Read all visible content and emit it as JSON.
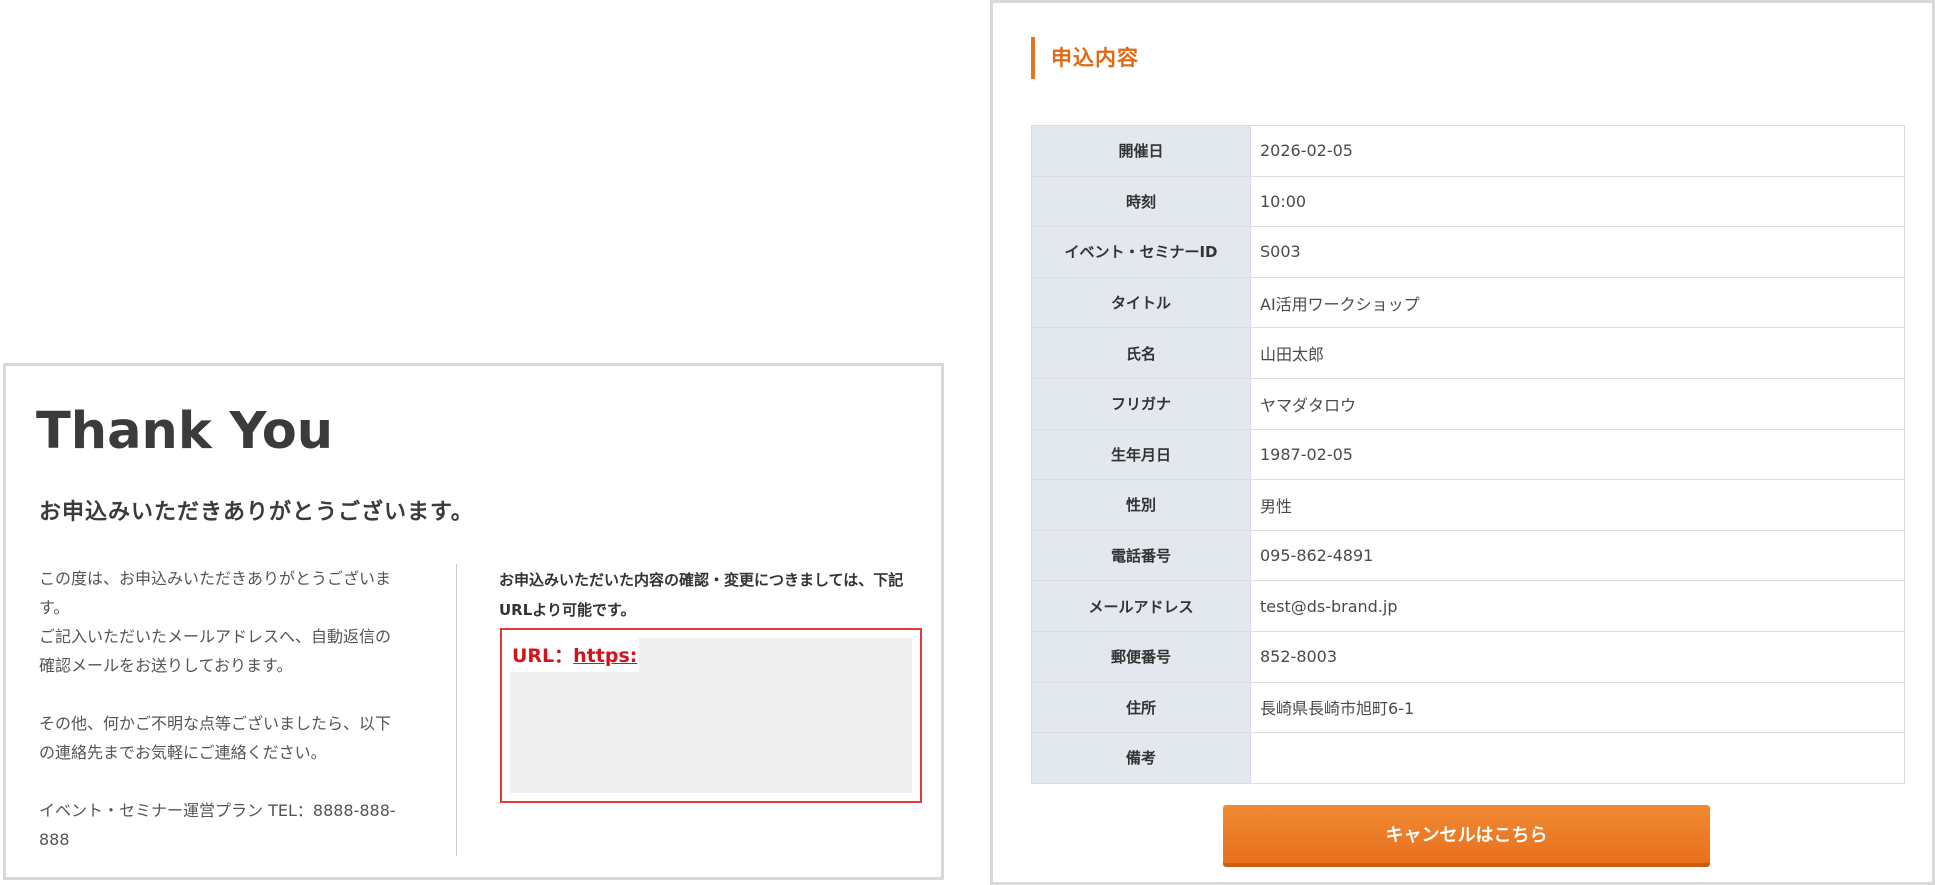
{
  "thanks": {
    "title": "Thank You",
    "subtitle": "お申込みいただきありがとうございます。",
    "paragraph1": "この度は、お申込みいただきありがとうございま\nす。\nご記入いただいたメールアドレスへ、自動返信の\n確認メールをお送りしております。",
    "paragraph2": "その他、何かご不明な点等ございましたら、以下\nの連絡先までお気軽にご連絡ください。",
    "paragraph3": "イベント・セミナー運営プラン TEL：8888-888-\n888",
    "note": "お申込みいただいた内容の確認・変更につきましては、下記URLより可能です。",
    "url_label": "URL：",
    "url_link": "https:"
  },
  "application": {
    "heading": "申込内容",
    "rows": [
      {
        "label": "開催日",
        "value": "2026-02-05"
      },
      {
        "label": "時刻",
        "value": "10:00"
      },
      {
        "label": "イベント・セミナーID",
        "value": "S003"
      },
      {
        "label": "タイトル",
        "value": "AI活用ワークショップ"
      },
      {
        "label": "氏名",
        "value": "山田太郎"
      },
      {
        "label": "フリガナ",
        "value": "ヤマダタロウ"
      },
      {
        "label": "生年月日",
        "value": "1987-02-05"
      },
      {
        "label": "性別",
        "value": "男性"
      },
      {
        "label": "電話番号",
        "value": "095-862-4891"
      },
      {
        "label": "メールアドレス",
        "value": "test@ds-brand.jp"
      },
      {
        "label": "郵便番号",
        "value": "852-8003"
      },
      {
        "label": "住所",
        "value": "長崎県長崎市旭町6-1"
      },
      {
        "label": "備考",
        "value": ""
      }
    ],
    "cancel_label": "キャンセルはこちら"
  },
  "colors": {
    "accent": "#e8731a",
    "url_red": "#d4141c",
    "table_header_bg": "#e3e8ef"
  }
}
